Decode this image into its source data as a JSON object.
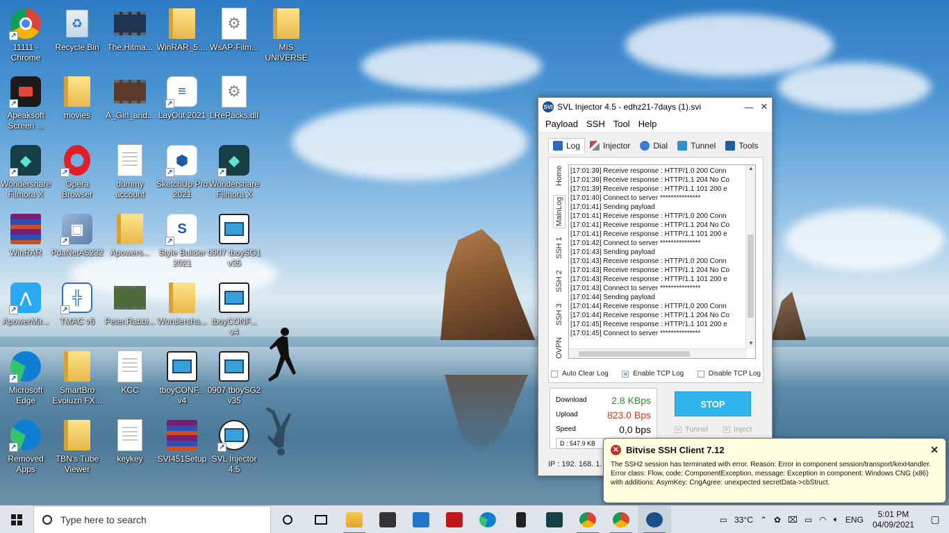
{
  "desktop_icons": [
    {
      "label": "11111 - Chrome"
    },
    {
      "label": "Recycle Bin"
    },
    {
      "label": "The.Hitma..."
    },
    {
      "label": "WinRAR_5...."
    },
    {
      "label": "WsAP-Film..."
    },
    {
      "label": "MIS UNIVERSE"
    },
    {
      "label": "Apeaksoft Screen ..."
    },
    {
      "label": "movies"
    },
    {
      "label": "A_Girl_and..."
    },
    {
      "label": "LayOut 2021"
    },
    {
      "label": "LRePacks.dll"
    },
    {
      "label": "Wondershare Filmora X"
    },
    {
      "label": "Opera Browser"
    },
    {
      "label": "dummy account"
    },
    {
      "label": "SketchUp Pro 2021"
    },
    {
      "label": "Wondershare Filmora X"
    },
    {
      "label": "WinRAR"
    },
    {
      "label": "PdaNetA5232"
    },
    {
      "label": "Apowers..."
    },
    {
      "label": "Style Builder 2021"
    },
    {
      "label": "0907 tboySG1 v35"
    },
    {
      "label": "ApowerMir..."
    },
    {
      "label": "TMAC v6"
    },
    {
      "label": "Peter.Rabbi..."
    },
    {
      "label": "Wondersha..."
    },
    {
      "label": "tboyCONF... v4"
    },
    {
      "label": "Microsoft Edge"
    },
    {
      "label": "SmartBro Evoluzn FX..."
    },
    {
      "label": "KCC"
    },
    {
      "label": "tboyCONF... v4"
    },
    {
      "label": "0907 tboySG2 v35"
    },
    {
      "label": "Removed Apps"
    },
    {
      "label": "TBN's Tube Viewer"
    },
    {
      "label": "keykey"
    },
    {
      "label": "SVI451Setup"
    },
    {
      "label": "SVL Injector 4.5"
    }
  ],
  "window": {
    "title": "SVL Injector 4.5 - edhz21-7days (1).svi",
    "menu": [
      "Payload",
      "SSH",
      "Tool",
      "Help"
    ],
    "tabs": [
      "Log",
      "Injector",
      "Dial",
      "Tunnel",
      "Tools"
    ],
    "side_tabs": [
      "Home",
      "MainLog",
      "SSH 1",
      "SSH 2",
      "SSH 3",
      "OVPN"
    ],
    "log_lines": [
      "[17:01:39] Receive response : HTTP/1.0 200 Conn",
      "[17:01:39] Receive response : HTTP/1.1 204 No Co",
      "[17:01:39] Receive response : HTTP/1.1 101 200 e",
      "[17:01:40] Connect to server ***************",
      "[17:01:41] Sending payload",
      "[17:01:41] Receive response : HTTP/1.0 200 Conn",
      "[17:01:41] Receive response : HTTP/1.1 204 No Co",
      "[17:01:41] Receive response : HTTP/1.1 101 200 e",
      "[17:01:42] Connect to server ***************",
      "[17:01:43] Sending payload",
      "[17:01:43] Receive response : HTTP/1.0 200 Conn",
      "[17:01:43] Receive response : HTTP/1.1 204 No Co",
      "[17:01:43] Receive response : HTTP/1.1 101 200 e",
      "[17:01:43] Connect to server ***************",
      "[17:01:44] Sending payload",
      "[17:01:44] Receive response : HTTP/1.0 200 Conn",
      "[17:01:44] Receive response : HTTP/1.1 204 No Co",
      "[17:01:45] Receive response : HTTP/1.1 101 200 e",
      "[17:01:45] Connect to server ***************"
    ],
    "options": {
      "auto_clear": "Auto Clear Log",
      "enable_tcp": "Enable TCP Log",
      "disable_tcp": "Disable TCP Log"
    },
    "stats": {
      "download_label": "Download",
      "download_value": "2.8 KBps",
      "upload_label": "Upload",
      "upload_value": "823.0 Bps",
      "speed_label": "Speed",
      "speed_value": "0,0 bps",
      "d_label": "D :",
      "d_value": "547.9 KB"
    },
    "stop_label": "STOP",
    "tunnel_label": "Tunnel",
    "inject_label": "Inject",
    "ip_label": "IP : 192. 168. 1. 1"
  },
  "notification": {
    "title": "Bitvise SSH Client 7.12",
    "message": "The SSH2 session has terminated with error. Reason: Error in component session/transport/kexHandler. Error class: Flow, code: ComponentException, message: Exception in component: Windows CNG (x86) with additions: AsymKey: CngAgree: unexpected secretData->cbStruct."
  },
  "taskbar": {
    "search_placeholder": "Type here to search",
    "temperature": "33°C",
    "language": "ENG",
    "time": "5:01 PM",
    "date": "04/09/2021"
  },
  "colors": {
    "download": "#2a8f2a",
    "upload": "#d23a1d",
    "stop_button": "#2fb4ee"
  }
}
